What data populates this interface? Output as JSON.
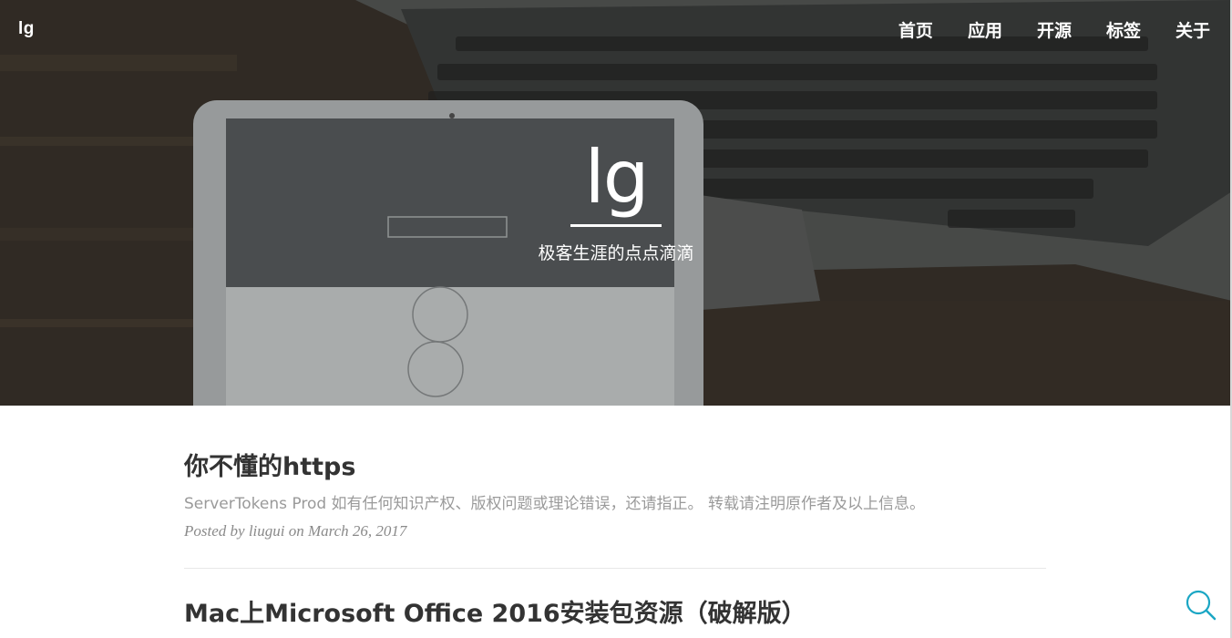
{
  "navbar": {
    "brand": "lg",
    "links": [
      "首页",
      "应用",
      "开源",
      "标签",
      "关于"
    ]
  },
  "hero": {
    "title": "lg",
    "subtitle": "极客生涯的点点滴滴"
  },
  "posts": [
    {
      "title": "你不懂的https",
      "subtitle": "ServerTokens Prod 如有任何知识产权、版权问题或理论错误，还请指正。 转载请注明原作者及以上信息。",
      "meta": "Posted by liugui on March 26, 2017"
    },
    {
      "title": "Mac上Microsoft Office 2016安装包资源（破解版）"
    }
  ],
  "colors": {
    "accent": "#1aa6c4",
    "title": "#333333",
    "subtitle": "#9a9a9a"
  },
  "icons": {
    "search": "search-icon"
  }
}
